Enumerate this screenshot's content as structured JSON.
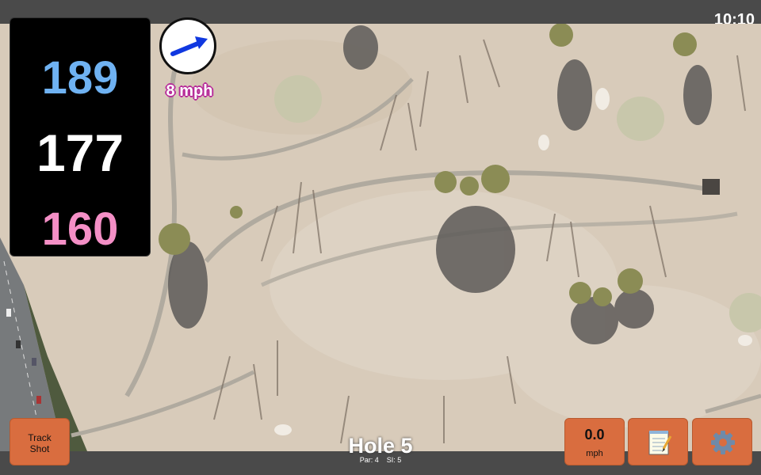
{
  "status": {
    "time": "10:10"
  },
  "distances": {
    "back": "189",
    "middle": "177",
    "front": "160"
  },
  "wind": {
    "speed": "8 mph",
    "icon": "wind-direction-arrow-icon"
  },
  "hole": {
    "title": "Hole 5",
    "par": "Par: 4",
    "si": "SI: 5"
  },
  "buttons": {
    "track_shot_line1": "Track",
    "track_shot_line2": "Shot",
    "speed_value": "0.0",
    "speed_unit": "mph",
    "notes_icon": "notepad-icon",
    "settings_icon": "gear-icon"
  },
  "colors": {
    "back_distance": "#6fb2f2",
    "middle_distance": "#ffffff",
    "front_distance": "#f48fc6",
    "button_orange": "#d96d3f",
    "wind_text_outline": "#b82e9a"
  }
}
